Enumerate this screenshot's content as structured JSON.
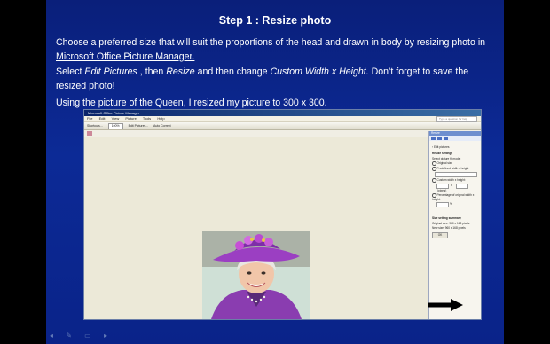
{
  "slide": {
    "title": "Step 1 : Resize photo",
    "p1_a": "Choose a preferred size that will suit the proportions of the head and drawn in body by resizing photo in ",
    "p1_link": "Microsoft Office Picture Manager.",
    "p2_a": "Select ",
    "p2_b": "Edit Pictures",
    "p2_c": " , then ",
    "p2_d": "Resize",
    "p2_e": " and then change ",
    "p2_f": "Custom Width x Height.",
    "p2_g": " Don’t forget to save the resized photo!",
    "p3": "Using the picture of the Queen, I resized my picture to 300 x 300."
  },
  "app": {
    "title": "Microsoft Office Picture Manager",
    "menu": [
      "File",
      "Edit",
      "View",
      "Picture",
      "Tools",
      "Help"
    ],
    "toolbar": {
      "shortcuts": "Shortcuts...",
      "zoom": "100%",
      "edit_pictures": "Edit Pictures...",
      "auto_correct": "Auto Correct"
    },
    "search_placeholder": "Type a question for help"
  },
  "taskpane": {
    "title": "Resize",
    "back_label": "‹ Edit pictures",
    "settings_heading": "Resize settings",
    "select_label": "Select picture fit mode:",
    "original_size": "Original size",
    "predefined": "Predefined width x height",
    "custom": "Custom width x height:",
    "x_sep": "x",
    "pixels": "(pixels)",
    "percentage": "Percentage of original width x height:",
    "percent_sign": "%",
    "summary_heading": "Size setting summary",
    "original_label": "Original size:",
    "original_value": "960 x 168 pixels",
    "new_label": "New size:",
    "new_value": "960 x 168 pixels",
    "ok": "OK"
  },
  "icons": [
    "arrow-right-icon",
    "queen-photo",
    "slideshow-nav-icons"
  ],
  "colors": {
    "slide_bg": "#0c2a96",
    "arrow": "#000000",
    "canvas": "#ece9d8"
  }
}
